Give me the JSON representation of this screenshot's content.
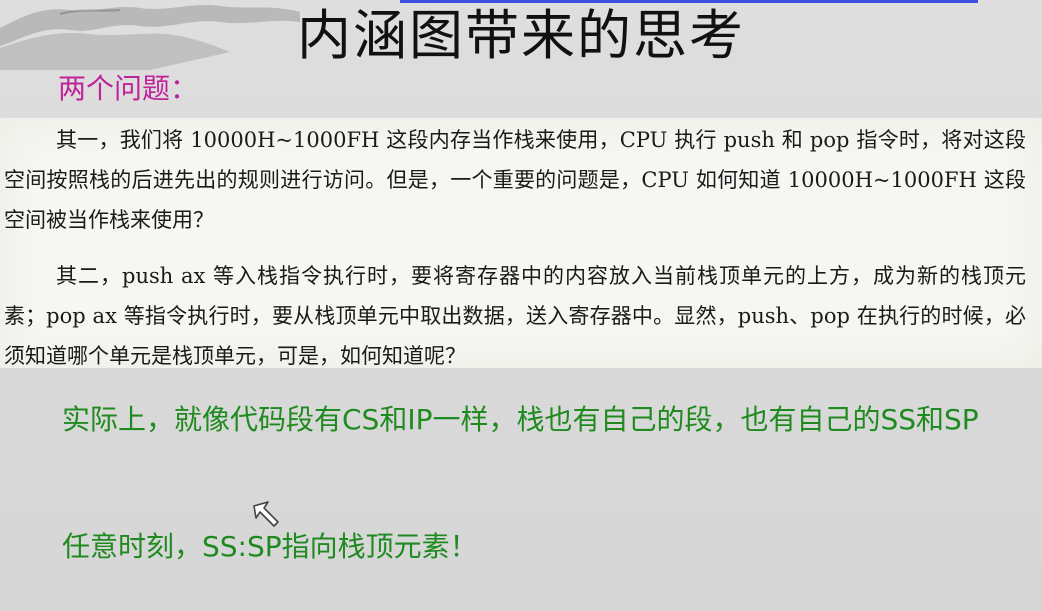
{
  "slide": {
    "title": "内涵图带来的思考",
    "subtitle": "两个问题：",
    "book_excerpt": {
      "paragraph_1": "其一，我们将 10000H~1000FH 这段内存当作栈来使用，CPU 执行 push 和 pop 指令时，将对这段空间按照栈的后进先出的规则进行访问。但是，一个重要的问题是，CPU 如何知道 10000H~1000FH 这段空间被当作栈来使用？",
      "paragraph_2": "其二，push ax 等入栈指令执行时，要将寄存器中的内容放入当前栈顶单元的上方，成为新的栈顶元素；pop ax 等指令执行时，要从栈顶单元中取出数据，送入寄存器中。显然，push、pop 在执行的时候，必须知道哪个单元是栈顶单元，可是，如何知道呢？"
    },
    "notes": [
      "实际上，就像代码段有CS和IP一样，栈也有自己的段，也有自己的SS和SP",
      "任意时刻，SS:SP指向栈顶元素！"
    ]
  },
  "colors": {
    "subtitle": "#c0229a",
    "notes": "#1f8a1f",
    "accent_strip": "#3f4fe0"
  },
  "icons": {
    "decoration": "ink-landscape-icon",
    "pointer": "mouse-cursor-icon"
  }
}
